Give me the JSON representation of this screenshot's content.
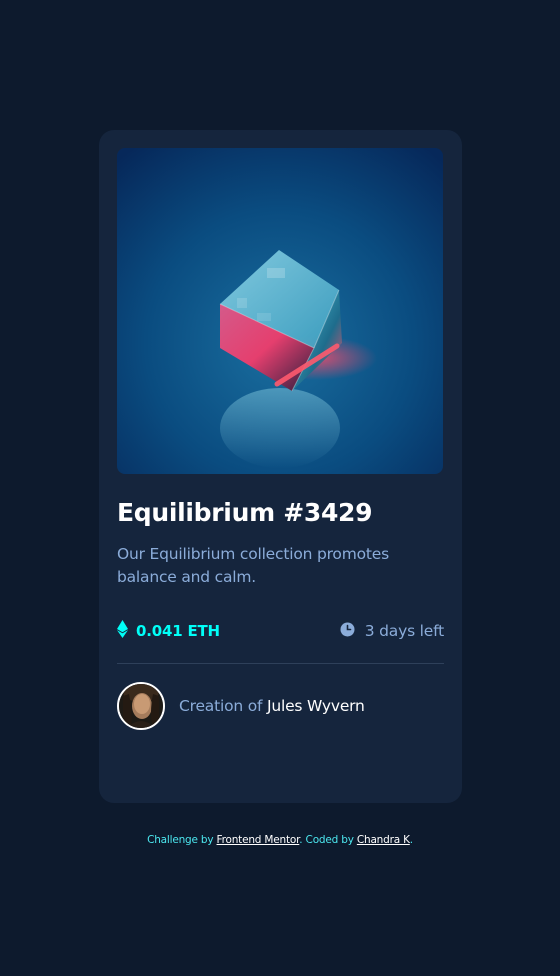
{
  "card": {
    "image_alt": "Equilibrium",
    "title": "Equilibrium #3429",
    "description": "Our Equilibrium collection promotes balance and calm.",
    "price": "0.041 ETH",
    "time_left": "3 days left",
    "creator_prefix": "Creation of ",
    "creator_name": "Jules Wyvern",
    "icons": {
      "price": "ethereum-icon",
      "time": "clock-icon"
    }
  },
  "attribution": {
    "prefix": "Challenge by ",
    "challenge_link": "Frontend Mentor",
    "middle": ". Coded by ",
    "author_link": "Chandra K",
    "suffix": "."
  },
  "colors": {
    "page_bg": "#0d1a2d",
    "card_bg": "#15253d",
    "accent_cyan": "#00fff8",
    "soft_blue": "#8bacd9",
    "white": "#ffffff",
    "divider": "#2e405a"
  }
}
